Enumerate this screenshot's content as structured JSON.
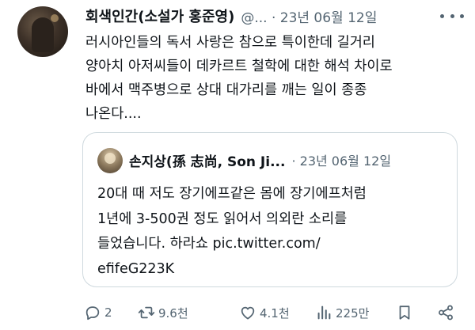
{
  "tweet": {
    "author_name": "회색인간(소설가 홍준영)",
    "meta": "@... · 23년 06월 12일",
    "text_lines": [
      "러시아인들의 독서 사랑은 참으로 특이한데 길거리",
      "양아치 아저씨들이 데카르트 철학에 대한 해석 차이로",
      "바에서 맥주병으로 상대 대가리를 깨는 일이 종종",
      "나온다...."
    ]
  },
  "quoted": {
    "author_name": "손지상(孫 志尚, Son Ji...",
    "meta": "· 23년 06월 12일",
    "text_lines": [
      "20대 때 저도 장기에프같은 몸에 장기에프처럼",
      "1년에 3-500권 정도 읽어서 의외란 소리를",
      "들었습니다. 하라쇼 pic.twitter.com/",
      "efifeG223K"
    ]
  },
  "actions": {
    "reply_count": "2",
    "retweet_count": "9.6천",
    "like_count": "4.1천",
    "view_count": "225만"
  },
  "icons": [
    "more-icon",
    "reply-icon",
    "retweet-icon",
    "like-icon",
    "views-icon",
    "bookmark-icon",
    "share-icon"
  ],
  "colors": {
    "text": "#0f1419",
    "secondary": "#536471",
    "border": "#cfd9de"
  }
}
